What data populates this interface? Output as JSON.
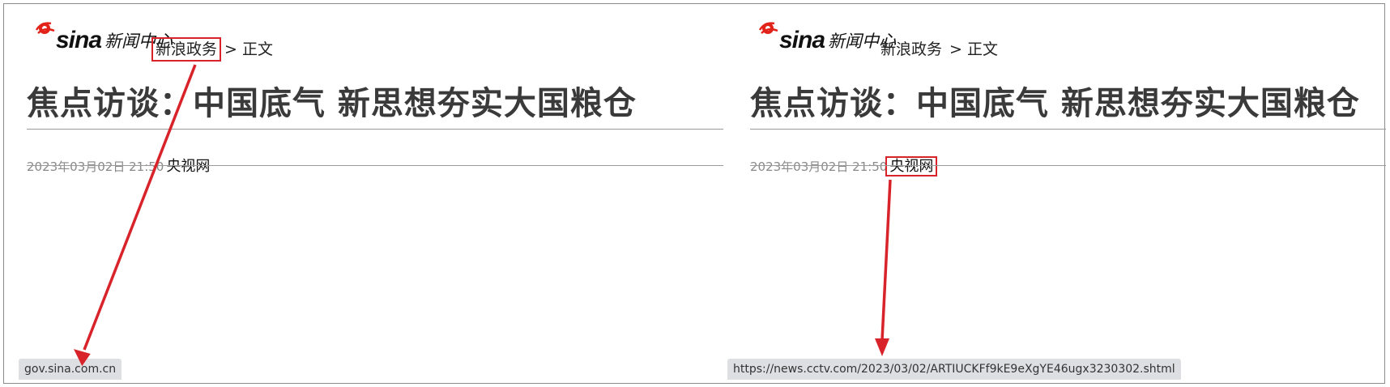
{
  "panels": [
    {
      "logo": {
        "wordmark": "sina",
        "section": "新闻中心"
      },
      "breadcrumb": {
        "category": "新浪政务",
        "separator": ">",
        "current": "正文"
      },
      "headline": "焦点访谈：中国底气 新思想夯实大国粮仓",
      "meta": {
        "timestamp": "2023年03月02日 21:50",
        "source": "央视网"
      },
      "statusbar_url": "gov.sina.com.cn",
      "highlight": "breadcrumb-category"
    },
    {
      "logo": {
        "wordmark": "sina",
        "section": "新闻中心"
      },
      "breadcrumb": {
        "category": "新浪政务",
        "separator": ">",
        "current": "正文"
      },
      "headline": "焦点访谈：中国底气 新思想夯实大国粮仓",
      "meta": {
        "timestamp": "2023年03月02日 21:50",
        "source": "央视网"
      },
      "statusbar_url": "https://news.cctv.com/2023/03/02/ARTIUCKFf9kE9eXgYE46ugx3230302.shtml",
      "highlight": "source-link"
    }
  ],
  "colors": {
    "annotation_red": "#d8232a",
    "logo_red": "#e2231a",
    "headline": "#3a3a3a",
    "statusbar_bg": "#dedfe3"
  },
  "icons": {
    "logo": "sina-eye-logo",
    "arrow": "red-arrow"
  }
}
